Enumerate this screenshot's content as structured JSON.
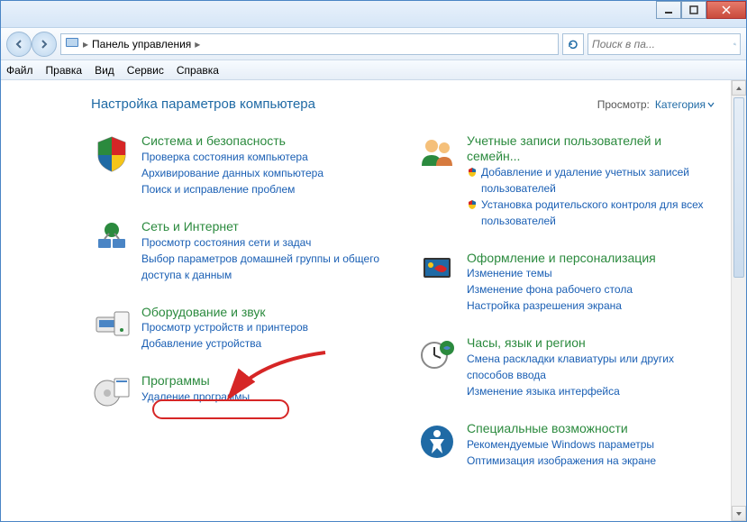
{
  "breadcrumb": {
    "text": "Панель управления",
    "sep": "▸"
  },
  "search": {
    "placeholder": "Поиск в па..."
  },
  "menu": {
    "file": "Файл",
    "edit": "Правка",
    "view": "Вид",
    "tools": "Сервис",
    "help": "Справка"
  },
  "heading": "Настройка параметров компьютера",
  "viewBy": {
    "label": "Просмотр:",
    "value": "Категория"
  },
  "left": [
    {
      "title": "Система и безопасность",
      "links": [
        "Проверка состояния компьютера",
        "Архивирование данных компьютера",
        "Поиск и исправление проблем"
      ]
    },
    {
      "title": "Сеть и Интернет",
      "links": [
        "Просмотр состояния сети и задач",
        "Выбор параметров домашней группы и общего доступа к данным"
      ]
    },
    {
      "title": "Оборудование и звук",
      "links": [
        "Просмотр устройств и принтеров",
        "Добавление устройства"
      ]
    },
    {
      "title": "Программы",
      "links": [
        "Удаление программы"
      ]
    }
  ],
  "right": [
    {
      "title": "Учетные записи пользователей и семейн...",
      "links": [
        "Добавление и удаление учетных записей пользователей",
        "Установка родительского контроля для всех пользователей"
      ],
      "shield": true
    },
    {
      "title": "Оформление и персонализация",
      "links": [
        "Изменение темы",
        "Изменение фона рабочего стола",
        "Настройка разрешения экрана"
      ]
    },
    {
      "title": "Часы, язык и регион",
      "links": [
        "Смена раскладки клавиатуры или других способов ввода",
        "Изменение языка интерфейса"
      ]
    },
    {
      "title": "Специальные возможности",
      "links": [
        "Рекомендуемые Windows параметры",
        "Оптимизация изображения на экране"
      ]
    }
  ]
}
